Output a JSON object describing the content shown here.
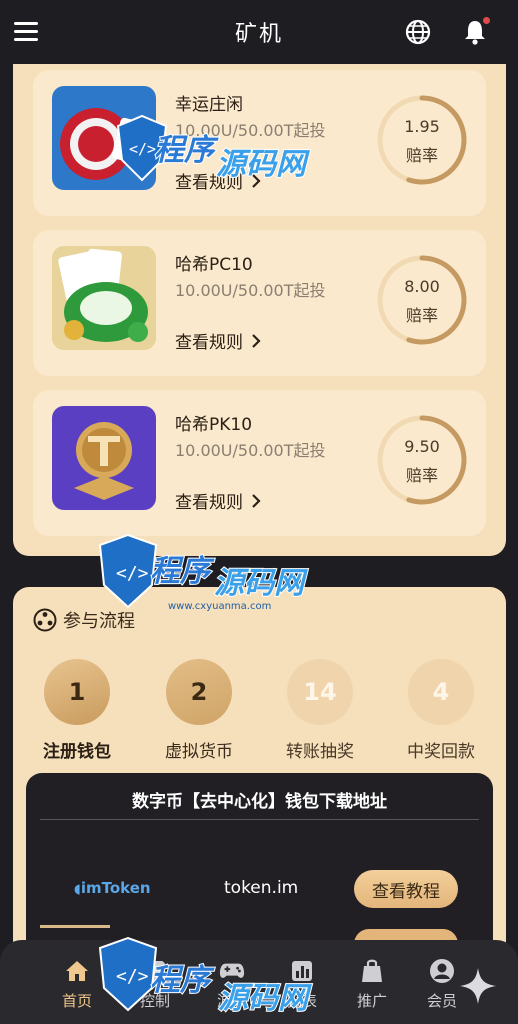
{
  "header": {
    "title": "矿机",
    "menu_icon": "hamburger-icon",
    "globe_icon": "globe-icon",
    "bell_icon": "bell-icon",
    "peek_text": "查看规则"
  },
  "games": [
    {
      "name": "幸运庄闲",
      "min": "10.00U/50.00T起投",
      "rule_label": "查看规则",
      "rate_value": "1.95",
      "rate_label": "赔率",
      "rate_fill": 0.55
    },
    {
      "name": "哈希PC10",
      "min": "10.00U/50.00T起投",
      "rule_label": "查看规则",
      "rate_value": "8.00",
      "rate_label": "赔率",
      "rate_fill": 0.55
    },
    {
      "name": "哈希PK10",
      "min": "10.00U/50.00T起投",
      "rule_label": "查看规则",
      "rate_value": "9.50",
      "rate_label": "赔率",
      "rate_fill": 0.55
    }
  ],
  "process": {
    "title": "参与流程",
    "steps": [
      {
        "number": "1",
        "label": "注册钱包"
      },
      {
        "number": "2",
        "label": "虚拟货币"
      },
      {
        "number": "14",
        "label": "转账抽奖"
      },
      {
        "number": "4",
        "label": "中奖回款"
      }
    ]
  },
  "wallet": {
    "title": "数字币【去中心化】钱包下载地址",
    "rows": [
      {
        "brand": "imToken",
        "url": "token.im",
        "button": "查看教程"
      }
    ]
  },
  "nav": {
    "items": [
      {
        "label": "首页",
        "icon": "home-icon"
      },
      {
        "label": "控制",
        "icon": "dice-icon"
      },
      {
        "label": "游戏",
        "icon": "gamepad-icon"
      },
      {
        "label": "报表",
        "icon": "chart-icon"
      },
      {
        "label": "推广",
        "icon": "bag-icon"
      },
      {
        "label": "会员",
        "icon": "user-icon"
      }
    ]
  },
  "watermark": {
    "text_a": "程序",
    "text_b": "源码网",
    "url": "www.cxyuanma.com"
  },
  "colors": {
    "accent": "#f0c78c",
    "panel": "#f6dfbb",
    "dark_bg": "#1e1d22"
  }
}
